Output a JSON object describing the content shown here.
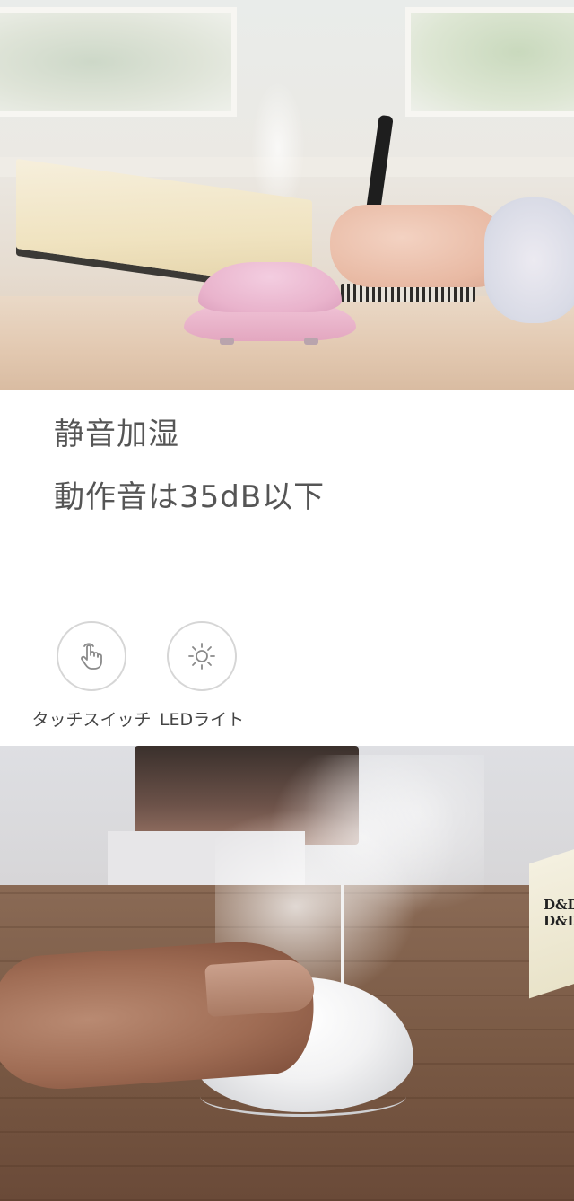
{
  "section": {
    "heading": "静音加湿",
    "subheading": "動作音は35dB以下"
  },
  "features": [
    {
      "icon": "touch-hand-icon",
      "label": "タッチスイッチ"
    },
    {
      "icon": "sun-led-icon",
      "label": "LEDライト"
    }
  ],
  "bottom_photo": {
    "book_text": "D&D\nD&D"
  },
  "colors": {
    "text": "#555555",
    "caption": "#444444",
    "icon_stroke": "#8a8a8a",
    "circle_border": "#d6d6d6",
    "humidifier_pink": "#e9b3cc"
  }
}
